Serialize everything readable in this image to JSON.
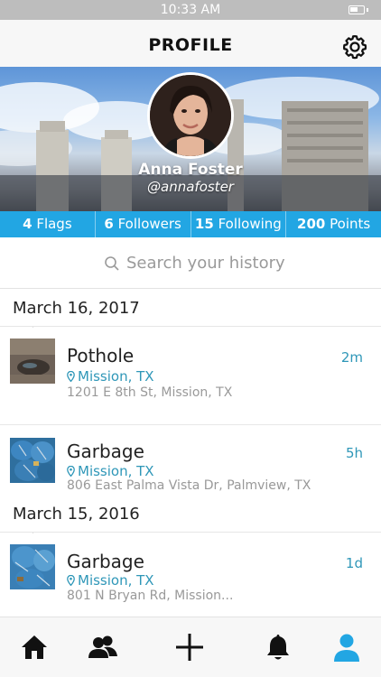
{
  "status_bar": {
    "time": "10:33 AM"
  },
  "header": {
    "title": "PROFILE",
    "settings_icon": "gear-icon"
  },
  "profile": {
    "name": "Anna Foster",
    "handle": "@annafoster"
  },
  "stats": [
    {
      "count": "4",
      "label": "Flags"
    },
    {
      "count": "6",
      "label": "Followers"
    },
    {
      "count": "15",
      "label": "Following"
    },
    {
      "count": "200",
      "label": "Points"
    }
  ],
  "search": {
    "placeholder": "Search your history"
  },
  "history": [
    {
      "date": "March 16, 2017",
      "items": [
        {
          "title": "Pothole",
          "location": "Mission, TX",
          "address": "1201 E 8th St, Mission, TX",
          "time": "2m"
        },
        {
          "title": "Garbage",
          "location": "Mission, TX",
          "address": "806 East Palma Vista Dr, Palmview, TX",
          "time": "5h"
        }
      ]
    },
    {
      "date": "March 15, 2016",
      "items": [
        {
          "title": "Garbage",
          "location": "Mission, TX",
          "address": "801 N Bryan Rd, Mission...",
          "time": "1d"
        }
      ]
    }
  ],
  "tab_bar": {
    "tabs": [
      "home-icon",
      "people-icon",
      "add-icon",
      "bell-icon",
      "profile-icon"
    ],
    "active": "profile-icon"
  },
  "colors": {
    "accent": "#22a6e3",
    "location": "#2f97b8",
    "muted": "#999999"
  }
}
